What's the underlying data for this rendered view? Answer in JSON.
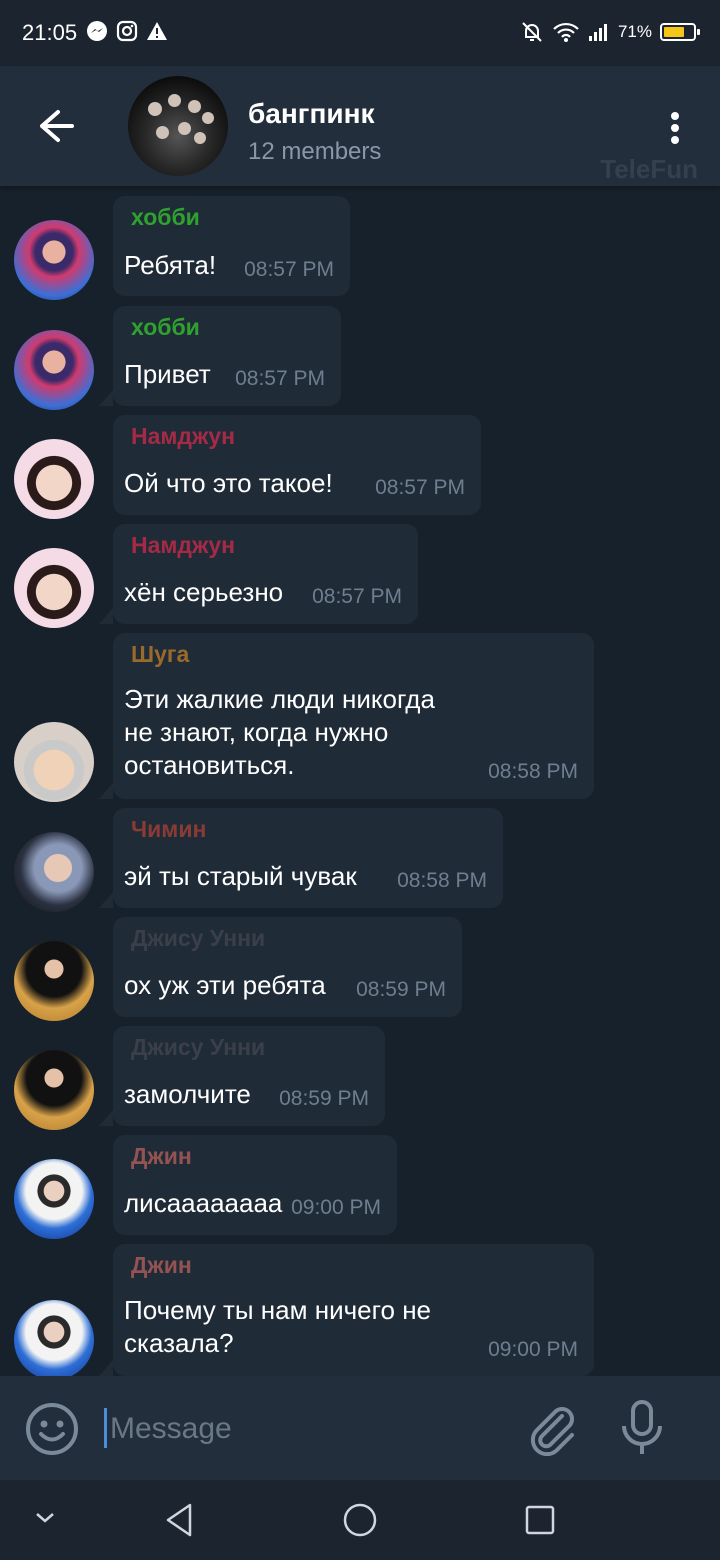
{
  "status": {
    "time": "21:05",
    "battery": "71%",
    "battery_level": 0.71
  },
  "header": {
    "title": "бангпинк",
    "subtitle": "12 members",
    "watermark": "TeleFun"
  },
  "messages": [
    {
      "sender": "хобби",
      "sender_color": "#2fa12f",
      "text": "Ребята!",
      "time": "08:57 PM"
    },
    {
      "sender": "хобби",
      "sender_color": "#2fa12f",
      "text": "Привет",
      "time": "08:57 PM"
    },
    {
      "sender": "Намджун",
      "sender_color": "#a52a45",
      "text": "Ой что это такое!",
      "time": "08:57 PM"
    },
    {
      "sender": "Намджун",
      "sender_color": "#a52a45",
      "text": "хён серьезно",
      "time": "08:57 PM"
    },
    {
      "sender": "Шуга",
      "sender_color": "#9a6a2c",
      "lines": [
        "Эти жалкие люди никогда",
        "не знают, когда нужно",
        "остановиться."
      ],
      "time": "08:58 PM"
    },
    {
      "sender": "Чимин",
      "sender_color": "#8a3b33",
      "text": "эй ты старый чувак",
      "time": "08:58 PM"
    },
    {
      "sender": "Джису Унни",
      "sender_color": "#3a3f4a",
      "text": "ох уж эти ребята",
      "time": "08:59 PM"
    },
    {
      "sender": "Джису Унни",
      "sender_color": "#3a3f4a",
      "text": "замолчите",
      "time": "08:59 PM"
    },
    {
      "sender": "Джин",
      "sender_color": "#945252",
      "text": "лисаааааааа",
      "time": "09:00 PM"
    },
    {
      "sender": "Джин",
      "sender_color": "#945252",
      "lines": [
        "Почему ты нам ничего не",
        "сказала?"
      ],
      "time": "09:00 PM"
    }
  ],
  "composer": {
    "placeholder": "Message"
  },
  "icons": {
    "back": "arrow-left-icon",
    "menu": "more-vertical-icon",
    "emoji": "emoji-icon",
    "attach": "paperclip-icon",
    "mic": "microphone-icon"
  }
}
